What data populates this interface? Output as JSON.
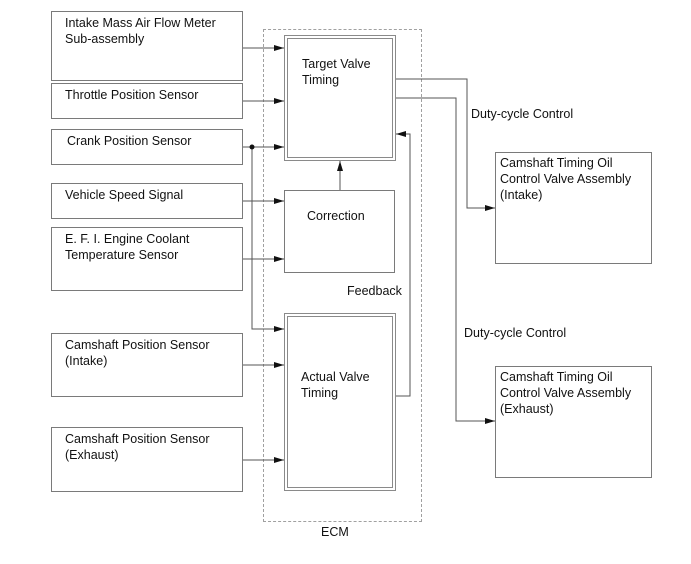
{
  "diagram": {
    "ecm_label": "ECM",
    "inputs": [
      {
        "id": "maf",
        "label": "Intake Mass Air Flow Meter\nSub-assembly"
      },
      {
        "id": "tps",
        "label": "Throttle Position Sensor"
      },
      {
        "id": "ckp",
        "label": "Crank Position Sensor"
      },
      {
        "id": "vss",
        "label": "Vehicle Speed Signal"
      },
      {
        "id": "ect",
        "label": "E. F. I. Engine Coolant\nTemperature Sensor"
      },
      {
        "id": "cmp_in",
        "label": "Camshaft Position Sensor\n(Intake)"
      },
      {
        "id": "cmp_ex",
        "label": "Camshaft Position Sensor\n(Exhaust)"
      }
    ],
    "ecm_blocks": [
      {
        "id": "target",
        "label": "Target Valve\nTiming"
      },
      {
        "id": "correction",
        "label": "Correction"
      },
      {
        "id": "actual",
        "label": "Actual Valve\nTiming"
      }
    ],
    "outputs": [
      {
        "id": "ocv_in",
        "label": "Camshaft Timing Oil\nControl Valve Assembly\n(Intake)"
      },
      {
        "id": "ocv_ex",
        "label": "Camshaft Timing Oil\nControl Valve Assembly\n(Exhaust)"
      }
    ],
    "annotations": {
      "duty_cycle_intake": "Duty-cycle Control",
      "duty_cycle_exhaust": "Duty-cycle Control",
      "feedback": "Feedback"
    },
    "connections": [
      {
        "from": "maf",
        "to": "target"
      },
      {
        "from": "tps",
        "to": "target"
      },
      {
        "from": "ckp",
        "to": "target"
      },
      {
        "from": "ckp",
        "to": "actual"
      },
      {
        "from": "vss",
        "to": "correction"
      },
      {
        "from": "ect",
        "to": "correction"
      },
      {
        "from": "correction",
        "to": "target"
      },
      {
        "from": "cmp_in",
        "to": "actual"
      },
      {
        "from": "cmp_ex",
        "to": "actual"
      },
      {
        "from": "actual",
        "to": "target",
        "label": "Feedback"
      },
      {
        "from": "target",
        "to": "ocv_in",
        "label": "Duty-cycle Control"
      },
      {
        "from": "target",
        "to": "ocv_ex",
        "label": "Duty-cycle Control"
      }
    ]
  }
}
